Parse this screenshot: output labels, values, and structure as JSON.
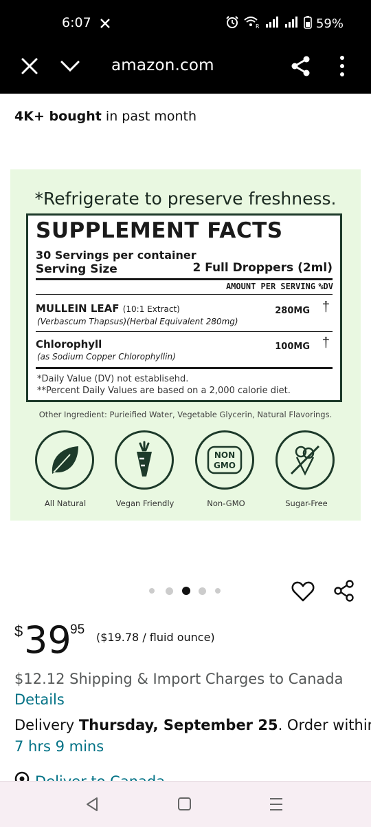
{
  "status_bar": {
    "time": "6:07",
    "battery": "59%",
    "icons": [
      "mute-icon",
      "alarm-icon",
      "wifi-icon",
      "signal-icon",
      "battery-icon"
    ]
  },
  "browser": {
    "url": "amazon.com",
    "icons": [
      "close-icon",
      "chevron-down-icon",
      "share-icon",
      "more-vert-icon"
    ]
  },
  "listing": {
    "bought_strong": "4K+ bought",
    "bought_rest": "in past month"
  },
  "product_image": {
    "refrigerate_note": "*Refrigerate to preserve freshness.",
    "facts_title": "SUPPLEMENT FACTS",
    "servings": "30 Servings per container",
    "serving_size_label": "Serving Size",
    "serving_size_value": "2 Full Droppers (2ml)",
    "amount_header": "AMOUNT PER SERVING",
    "dv_header": "%DV",
    "ingredients": [
      {
        "name": "MULLEIN LEAF",
        "name_extra": "(10:1 Extract)",
        "sub": "(Verbascum Thapsus)(Herbal Equivalent 280mg)",
        "amount": "280MG",
        "dv": "†"
      },
      {
        "name": "Chlorophyll",
        "name_extra": "",
        "sub": "(as Sodium Copper Chlorophyllin)",
        "amount": "100MG",
        "dv": "†"
      }
    ],
    "note1": "*Daily Value (DV) not establisehd.",
    "note2": "**Percent Daily Values are based on a 2,000 calorie diet.",
    "other_ingredients": "Other Ingredient: Purieified Water, Vegetable Glycerin, Natural Flavorings.",
    "badges": [
      {
        "label": "All Natural",
        "icon": "leaf-icon"
      },
      {
        "label": "Vegan Friendly",
        "icon": "carrot-icon"
      },
      {
        "label": "Non-GMO",
        "icon": "non-gmo-icon",
        "text": [
          "NON",
          "GMO"
        ]
      },
      {
        "label": "Sugar-Free",
        "icon": "sugar-free-icon"
      }
    ]
  },
  "carousel": {
    "count": 5,
    "active_index": 2
  },
  "price": {
    "currency": "$",
    "whole": "39",
    "fraction": "95",
    "unit_price": "($19.78 / fluid ounce)"
  },
  "shipping": {
    "text": "$12.12 Shipping & Import Charges to Canada",
    "details_link": "Details"
  },
  "delivery": {
    "prefix": "Delivery",
    "date": "Thursday, September 25",
    "suffix": ". Order within",
    "countdown": "7 hrs 9 mins"
  },
  "deliver_to": "Deliver to Canada",
  "nav": {
    "icons": [
      "back-icon",
      "home-icon",
      "recents-icon"
    ]
  },
  "colors": {
    "link": "#007185",
    "image_bg": "#e9f8e1",
    "dark_green": "#1d3a2a",
    "nav_bg": "#f7eef3"
  }
}
